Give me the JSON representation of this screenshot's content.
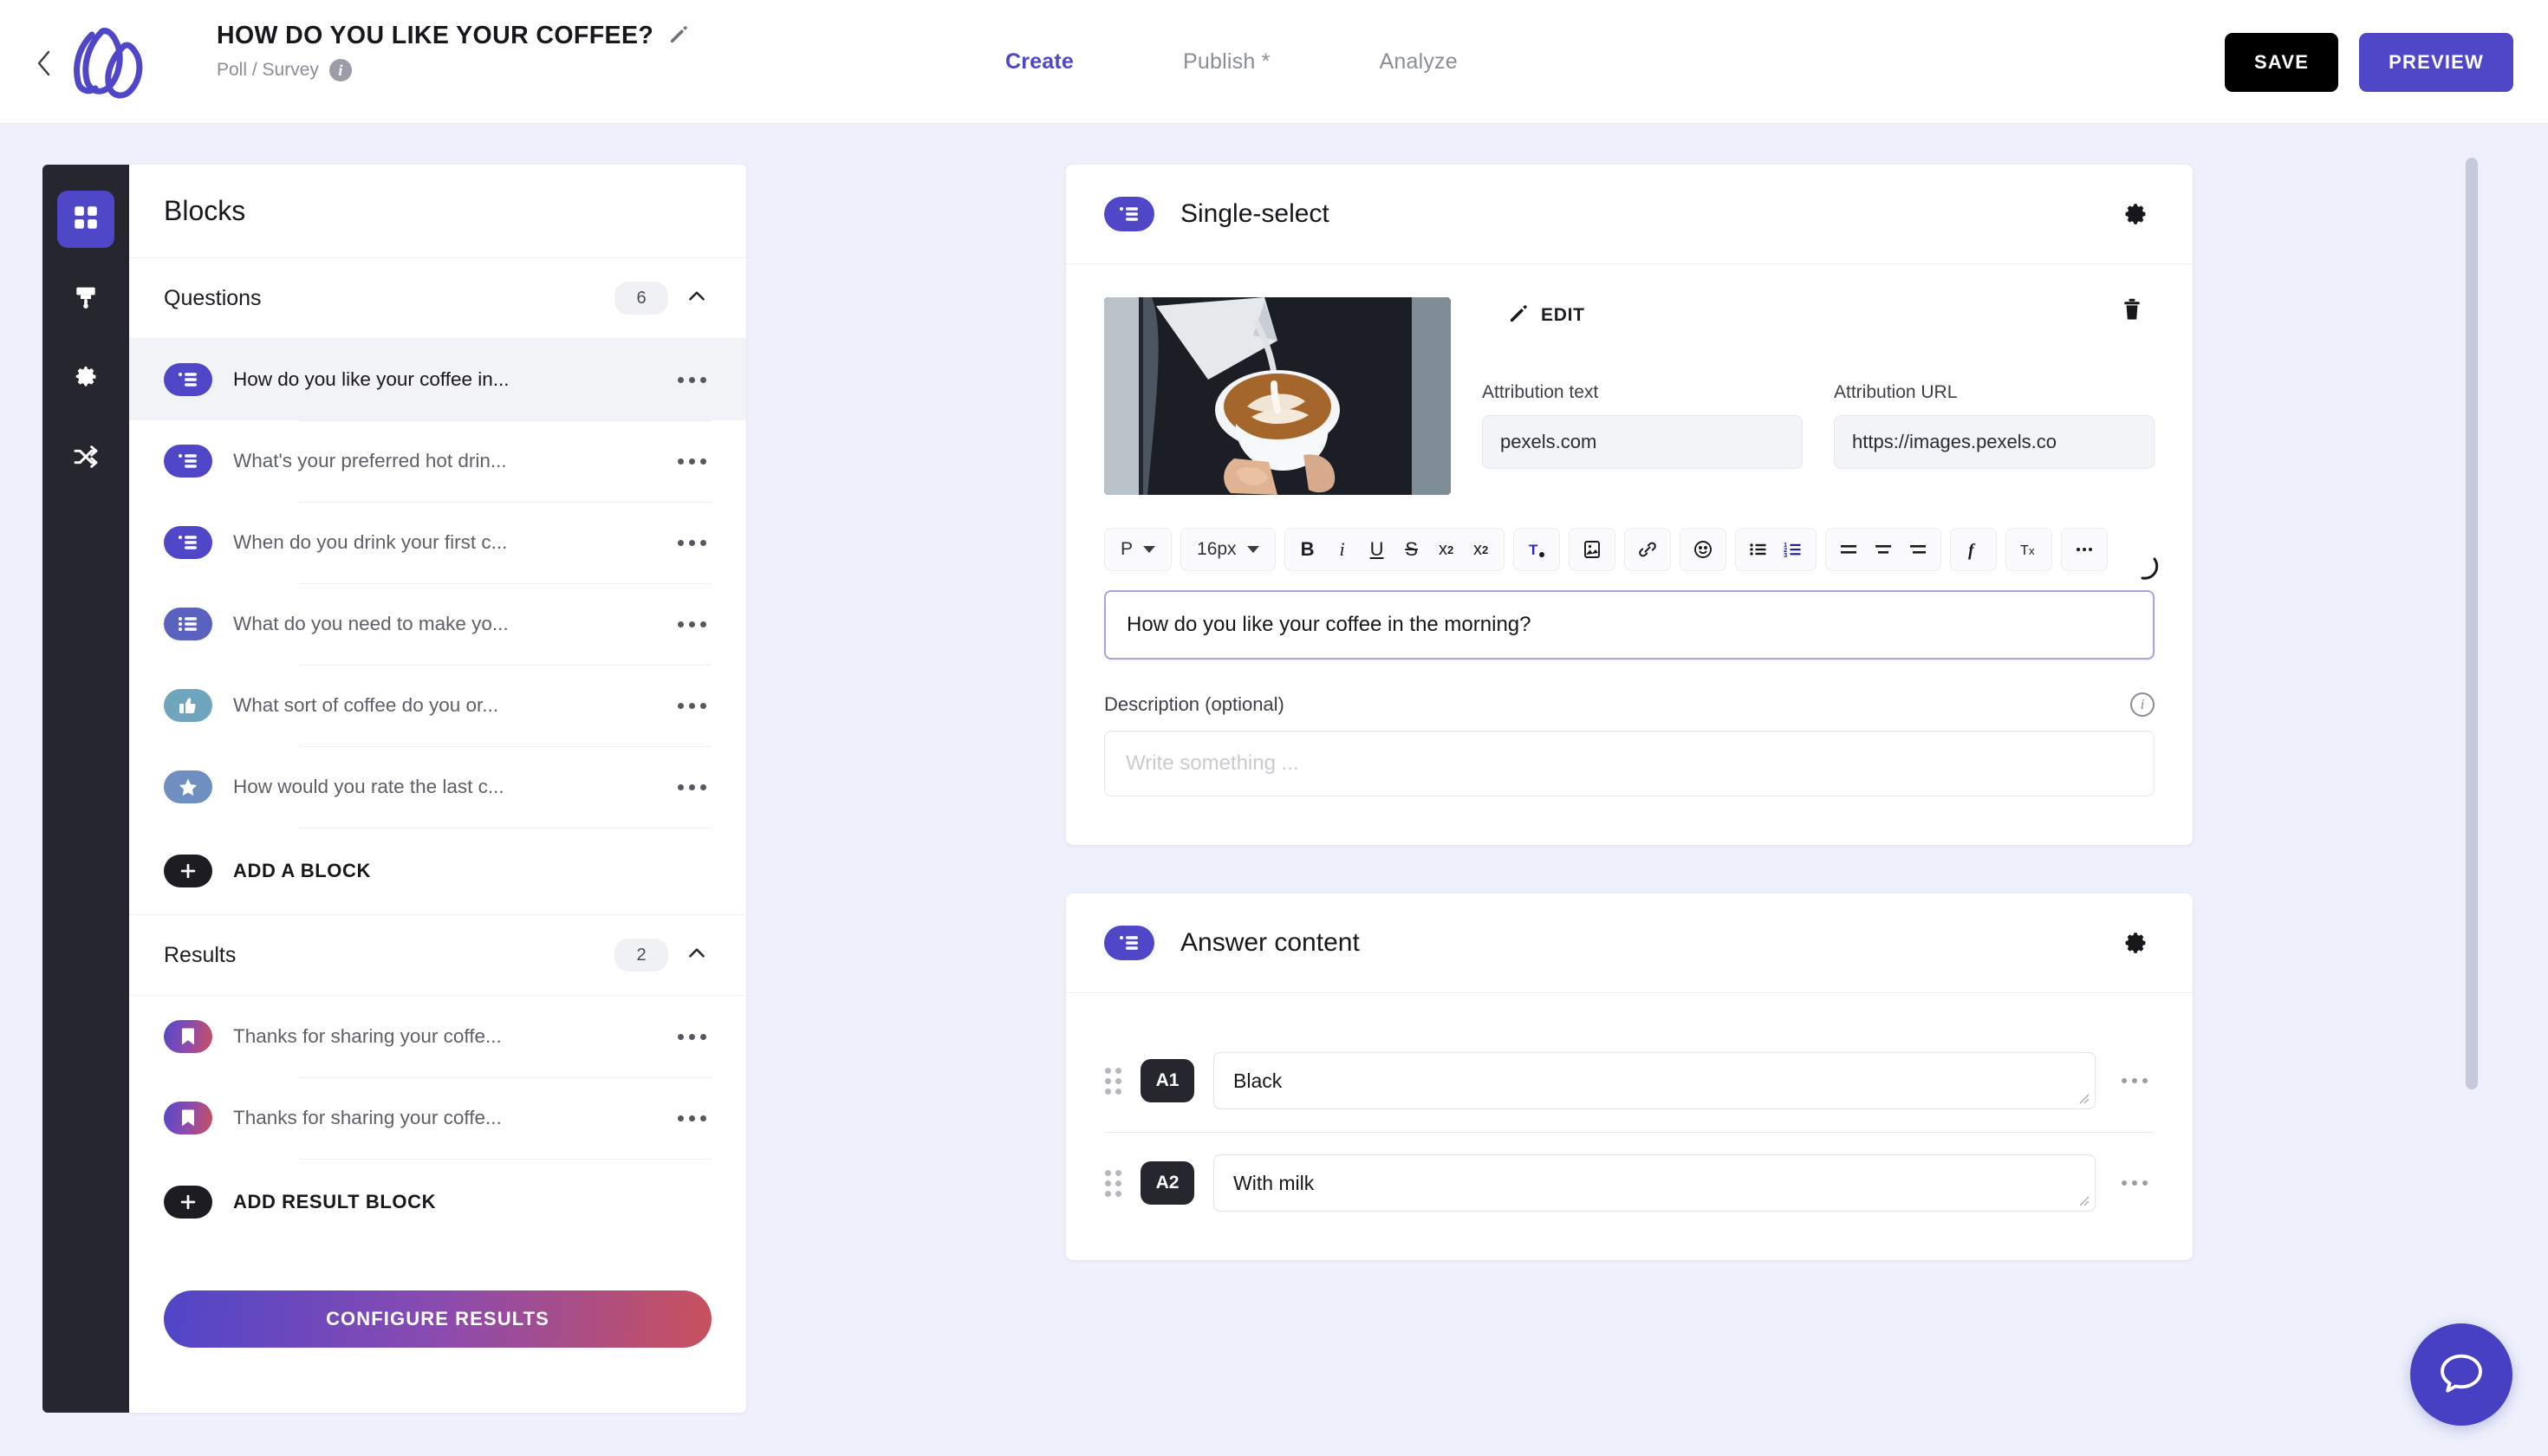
{
  "header": {
    "back_icon": "chevron-left-icon",
    "logo_icon": "brand-logo-icon",
    "title": "HOW DO YOU LIKE YOUR COFFEE?",
    "title_edit_icon": "pencil-icon",
    "subtitle": "Poll / Survey",
    "subtitle_info_icon": "info-icon",
    "info_glyph": "i",
    "tabs": [
      {
        "label": "Create",
        "active": true
      },
      {
        "label": "Publish *",
        "active": false
      },
      {
        "label": "Analyze",
        "active": false
      }
    ],
    "save_label": "SAVE",
    "preview_label": "PREVIEW"
  },
  "rail": {
    "items": [
      {
        "icon": "blocks-grid-icon",
        "active": true
      },
      {
        "icon": "paintbrush-icon",
        "active": false
      },
      {
        "icon": "gear-icon",
        "active": false
      },
      {
        "icon": "share-nodes-icon",
        "active": false
      }
    ]
  },
  "blocks_panel": {
    "title": "Blocks",
    "questions": {
      "label": "Questions",
      "count": "6",
      "collapse_icon": "chevron-up-icon",
      "items": [
        {
          "label": "How do you like your coffee in...",
          "icon": "single-select-icon",
          "kind": "single",
          "selected": true
        },
        {
          "label": "What's your preferred hot drin...",
          "icon": "single-select-icon",
          "kind": "single",
          "selected": false
        },
        {
          "label": "When do you drink your first c...",
          "icon": "single-select-icon",
          "kind": "single",
          "selected": false
        },
        {
          "label": "What do you need to make yo...",
          "icon": "multi-select-icon",
          "kind": "multi",
          "selected": false
        },
        {
          "label": "What sort of coffee do you or...",
          "icon": "thumbs-up-icon",
          "kind": "thumbs",
          "selected": false
        },
        {
          "label": "How would you rate the last c...",
          "icon": "star-icon",
          "kind": "star",
          "selected": false
        }
      ],
      "add_label": "ADD A BLOCK",
      "add_icon": "plus-icon"
    },
    "results": {
      "label": "Results",
      "count": "2",
      "collapse_icon": "chevron-up-icon",
      "items": [
        {
          "label": "Thanks for sharing your coffe...",
          "icon": "bookmark-icon",
          "kind": "result"
        },
        {
          "label": "Thanks for sharing your coffe...",
          "icon": "bookmark-icon",
          "kind": "result"
        }
      ],
      "add_label": "ADD RESULT BLOCK",
      "add_icon": "plus-icon"
    },
    "configure_label": "CONFIGURE RESULTS",
    "row_menu_icon": "ellipsis-icon"
  },
  "question_card": {
    "type_icon": "single-select-icon",
    "title": "Single-select",
    "settings_icon": "gear-icon",
    "media": {
      "thumbnail_icon": "coffee-latte-photo",
      "edit_icon": "pencil-icon",
      "edit_label": "EDIT",
      "delete_icon": "trash-icon",
      "attribution_text_label": "Attribution text",
      "attribution_text_value": "pexels.com",
      "attribution_url_label": "Attribution URL",
      "attribution_url_value": "https://images.pexels.co"
    },
    "toolbar": {
      "paragraph_style": "P",
      "font_size": "16px",
      "bold": "B",
      "italic": "i",
      "underline": "U",
      "strikethrough": "S",
      "superscript": "x",
      "superscript_exp": "2",
      "subscript": "x",
      "subscript_exp": "2",
      "text_color_icon": "text-color-icon",
      "image_icon": "insert-image-icon",
      "link_icon": "link-icon",
      "emoji_icon": "emoji-icon",
      "bullet_list_icon": "bullet-list-icon",
      "numbered_list_icon": "numbered-list-icon",
      "align_left_icon": "align-left-icon",
      "align_center_icon": "align-center-icon",
      "align_right_icon": "align-right-icon",
      "function_icon": "formula-icon",
      "clear_format_icon": "clear-formatting-icon",
      "overflow_icon": "ellipsis-icon"
    },
    "question_value": "How do you like your coffee in the morning?",
    "description_label": "Description (optional)",
    "description_info_icon": "info-icon",
    "description_placeholder": "Write something ..."
  },
  "answer_card": {
    "type_icon": "single-select-icon",
    "title": "Answer content",
    "settings_icon": "gear-icon",
    "rows": [
      {
        "chip": "A1",
        "value": "Black",
        "grip_icon": "drag-handle-icon",
        "menu_icon": "ellipsis-icon"
      },
      {
        "chip": "A2",
        "value": "With milk",
        "grip_icon": "drag-handle-icon",
        "menu_icon": "ellipsis-icon"
      }
    ]
  },
  "chat": {
    "icon": "chat-bubble-icon"
  },
  "scrollbar": {
    "icon": "vertical-scrollbar"
  },
  "colors": {
    "accent": "#5046c8",
    "dark": "#26262e",
    "page_bg": "#eef1fb",
    "result_gradient_start": "#4f46c8",
    "result_gradient_end": "#c9505c"
  }
}
